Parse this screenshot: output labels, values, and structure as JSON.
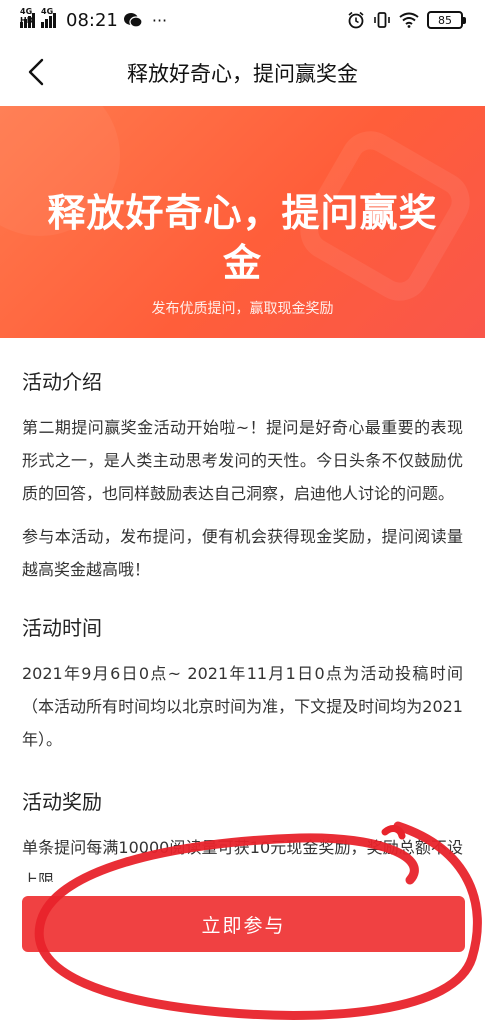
{
  "status_bar": {
    "signal1": "4G HD",
    "signal2": "4G",
    "time": "08:21",
    "battery": "85"
  },
  "nav": {
    "title": "释放好奇心，提问赢奖金"
  },
  "banner": {
    "title": "释放好奇心，提问赢奖金",
    "subtitle": "发布优质提问，赢取现金奖励"
  },
  "sections": [
    {
      "title": "活动介绍",
      "paragraphs": [
        "第二期提问赢奖金活动开始啦~！提问是好奇心最重要的表现形式之一，是人类主动思考发问的天性。今日头条不仅鼓励优质的回答，也同样鼓励表达自己洞察，启迪他人讨论的问题。",
        "参与本活动，发布提问，便有机会获得现金奖励，提问阅读量越高奖金越高哦！"
      ]
    },
    {
      "title": "活动时间",
      "paragraphs": [
        "2021年9月6日0点~ 2021年11月1日0点为活动投稿时间（本活动所有时间均以北京时间为准，下文提及时间均为2021年）。"
      ]
    },
    {
      "title": "活动奖励",
      "paragraphs": [
        "单条提问每满10000阅读量可获10元现金奖励，奖励总额不设上限"
      ]
    }
  ],
  "cta": {
    "label": "立即参与"
  },
  "colors": {
    "banner_start": "#ff7a4d",
    "banner_end": "#f9564a",
    "cta": "#f04142",
    "annotation": "#e8232b"
  }
}
